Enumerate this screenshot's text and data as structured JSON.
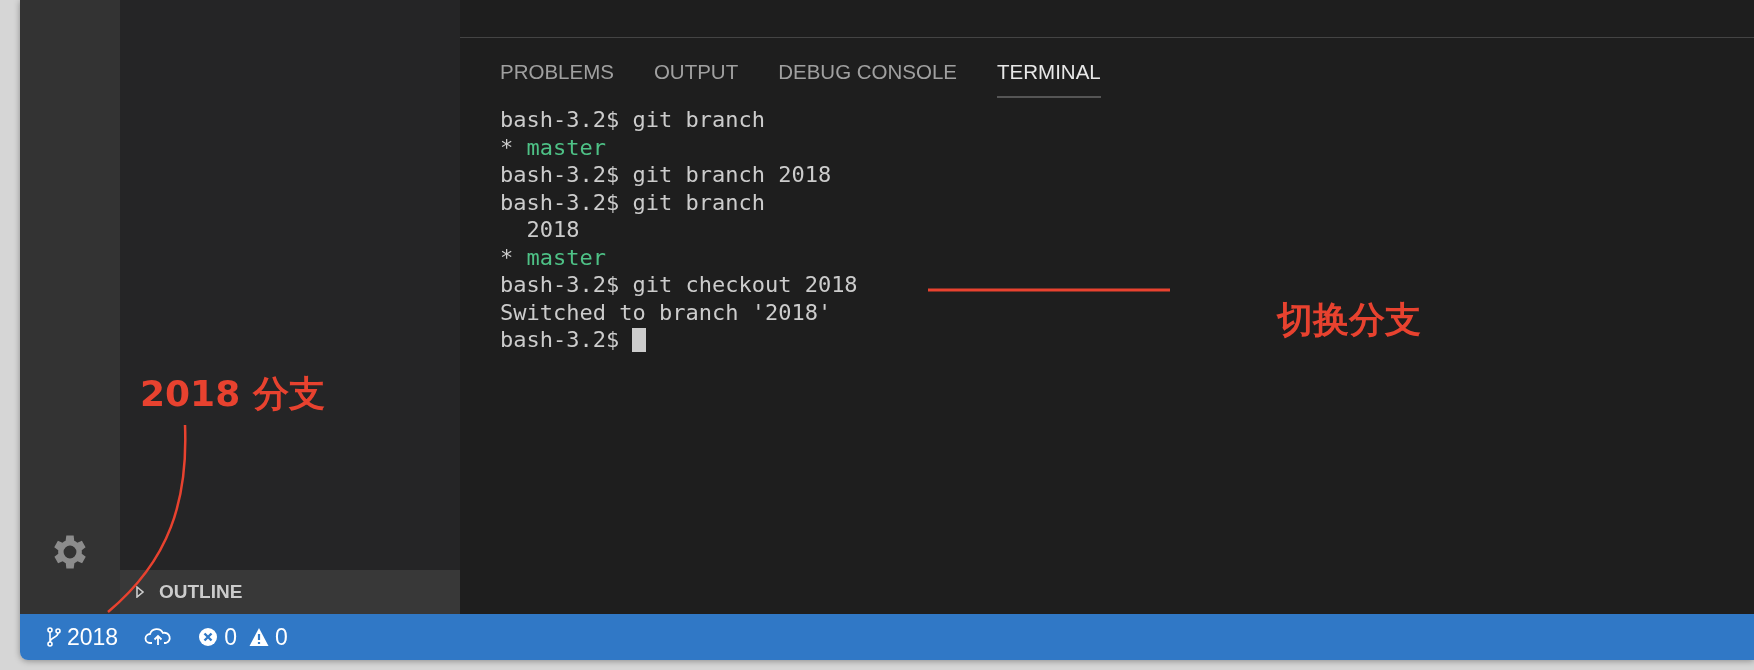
{
  "panel": {
    "tabs": [
      {
        "label": "PROBLEMS",
        "selected": false
      },
      {
        "label": "OUTPUT",
        "selected": false
      },
      {
        "label": "DEBUG CONSOLE",
        "selected": false
      },
      {
        "label": "TERMINAL",
        "selected": true
      }
    ],
    "terminal_lines": [
      {
        "kind": "plain",
        "text": "bash-3.2$ git branch"
      },
      {
        "kind": "current-branch",
        "marker": "*",
        "text": "master"
      },
      {
        "kind": "plain",
        "text": "bash-3.2$ git branch 2018"
      },
      {
        "kind": "plain",
        "text": "bash-3.2$ git branch"
      },
      {
        "kind": "plain",
        "text": "  2018"
      },
      {
        "kind": "current-branch",
        "marker": "*",
        "text": "master"
      },
      {
        "kind": "plain",
        "text": "bash-3.2$ git checkout 2018"
      },
      {
        "kind": "plain",
        "text": "Switched to branch '2018'"
      },
      {
        "kind": "prompt-cursor",
        "text": "bash-3.2$"
      }
    ]
  },
  "sidebar": {
    "outline": {
      "label": "OUTLINE",
      "expanded": false
    }
  },
  "status_bar": {
    "branch": "2018",
    "errors": "0",
    "warnings": "0"
  },
  "annotations": [
    {
      "kind": "curve",
      "text": "2018 分支"
    },
    {
      "kind": "straight",
      "text": "切换分支"
    }
  ]
}
